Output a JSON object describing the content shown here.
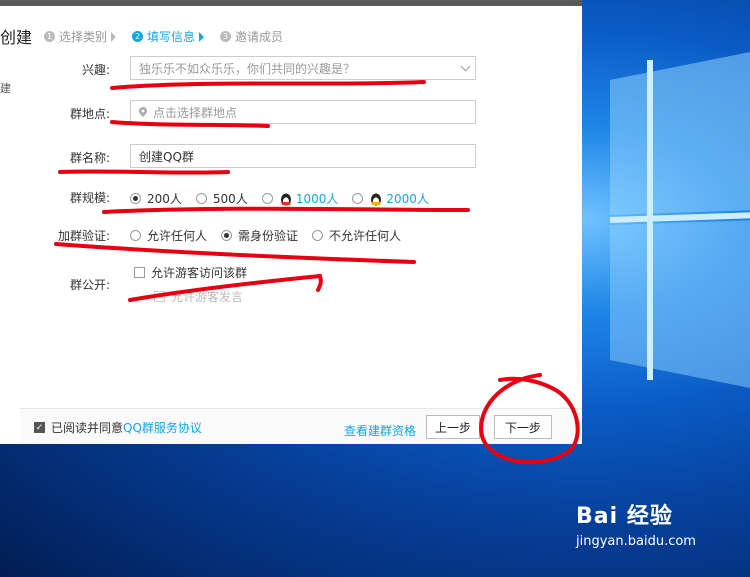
{
  "window": {
    "title_fragment": "创建",
    "side_fragment": "建"
  },
  "steps": [
    {
      "num": "1",
      "label": "选择类别"
    },
    {
      "num": "2",
      "label": "填写信息"
    },
    {
      "num": "3",
      "label": "邀请成员"
    }
  ],
  "form": {
    "interest": {
      "label": "兴趣:",
      "placeholder": "独乐乐不如众乐乐，你们共同的兴趣是？"
    },
    "location": {
      "label": "群地点:",
      "placeholder": "点击选择群地点"
    },
    "name": {
      "label": "群名称:",
      "value": "创建QQ群"
    },
    "scale": {
      "label": "群规模:",
      "options": [
        "200人",
        "500人",
        "1000人",
        "2000人"
      ],
      "selected": "200人"
    },
    "verify": {
      "label": "加群验证:",
      "options": [
        "允许任何人",
        "需身份验证",
        "不允许任何人"
      ],
      "selected": "需身份验证"
    },
    "public": {
      "label": "群公开:",
      "options": [
        "允许游客访问该群",
        "允许游客发言"
      ]
    }
  },
  "footer": {
    "agree_prefix": "已阅读并同意",
    "agree_link": "QQ群服务协议",
    "qualification_link": "查看建群资格",
    "prev_button": "上一步",
    "next_button": "下一步"
  },
  "watermark": {
    "brand": "Bai 经验",
    "url": "jingyan.baidu.com"
  },
  "colors": {
    "accent": "#12a6e6",
    "annotation": "#e60012"
  }
}
